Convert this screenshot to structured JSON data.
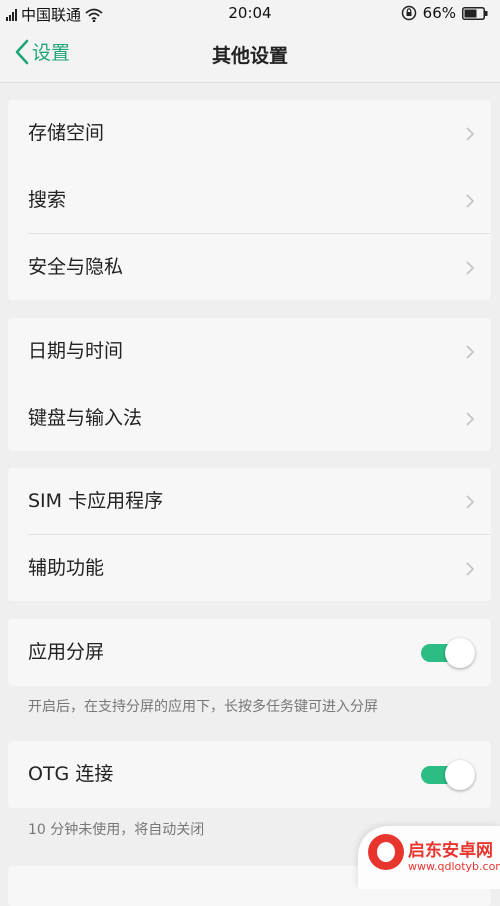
{
  "status_bar": {
    "carrier": "中国联通",
    "time": "20:04",
    "battery": "66%",
    "icons": [
      "signal-icon",
      "wifi-icon",
      "rotation-lock-icon",
      "battery-icon"
    ]
  },
  "nav": {
    "back_label": "设置",
    "title": "其他设置"
  },
  "groups": [
    {
      "items": [
        {
          "label": "存储空间"
        },
        {
          "label": "搜索"
        },
        {
          "label": "安全与隐私"
        }
      ]
    },
    {
      "items": [
        {
          "label": "日期与时间"
        },
        {
          "label": "键盘与输入法"
        }
      ]
    },
    {
      "items": [
        {
          "label": "SIM 卡应用程序"
        },
        {
          "label": "辅助功能"
        }
      ]
    }
  ],
  "toggles": [
    {
      "label": "应用分屏",
      "on": true,
      "description": "开启后，在支持分屏的应用下，长按多任务键可进入分屏"
    },
    {
      "label": "OTG 连接",
      "on": true,
      "description": "10 分钟未使用，将自动关闭"
    }
  ],
  "colors": {
    "accent": "#21a67a",
    "toggle_on": "#2cbd85",
    "background": "#efefef",
    "card": "#f7f7f7"
  },
  "watermark": {
    "title": "启东安卓网",
    "url": "www.qdlotyb.com"
  }
}
